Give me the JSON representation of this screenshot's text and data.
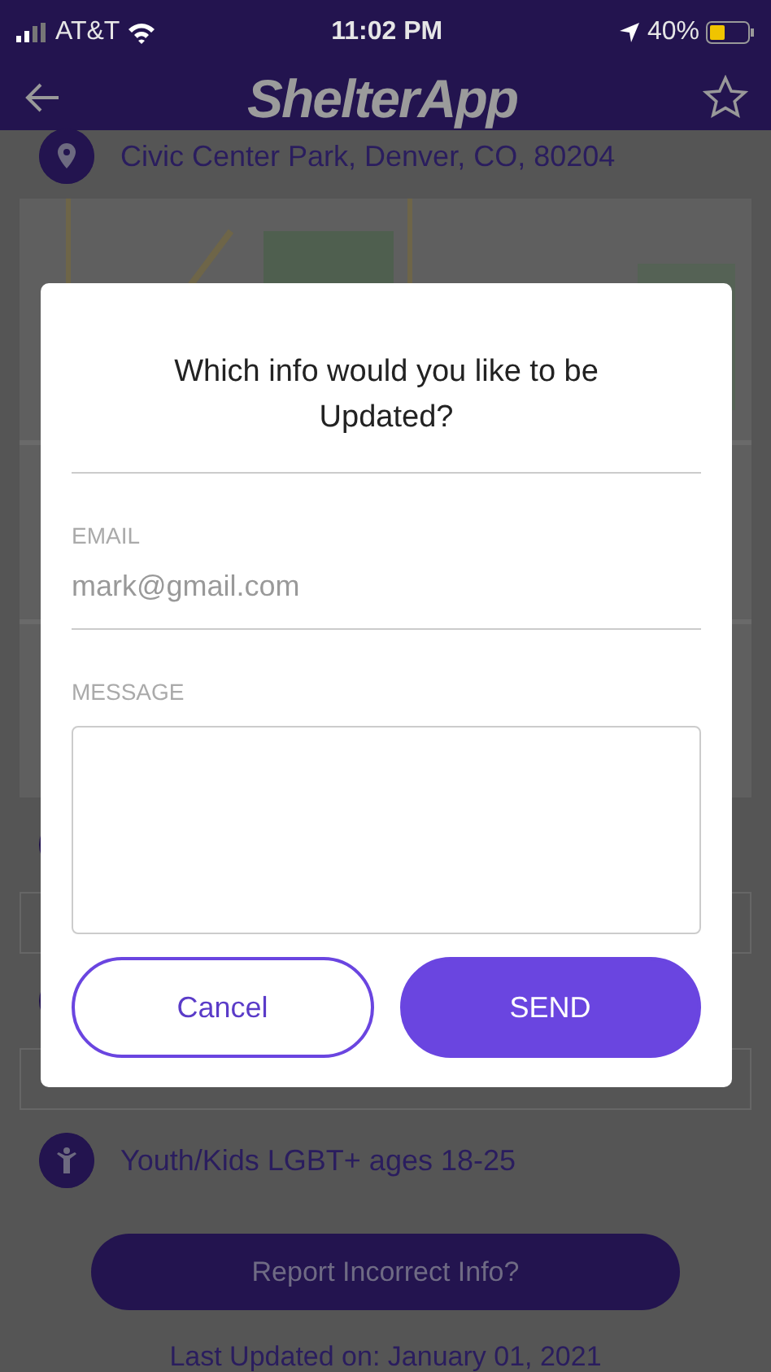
{
  "status_bar": {
    "carrier": "AT&T",
    "time": "11:02 PM",
    "battery": "40%"
  },
  "header": {
    "title": "ShelterApp"
  },
  "location": {
    "address": "Civic Center Park, Denver, CO, 80204"
  },
  "category": {
    "label": "Youth/Kids LGBT+ ages 18-25"
  },
  "report_button": {
    "label": "Report Incorrect Info?"
  },
  "last_updated": "Last Updated on: January 01, 2021",
  "dialog": {
    "title": "Which info would you like to be Updated?",
    "fields": [
      {
        "label": "EMAIL",
        "placeholder": "mark@gmail.com",
        "kind": "line"
      },
      {
        "label": "MESSAGE",
        "kind": "area"
      }
    ],
    "buttons": [
      {
        "label": "Cancel",
        "kind": "outline"
      },
      {
        "label": "SEND",
        "kind": "filled"
      }
    ]
  }
}
